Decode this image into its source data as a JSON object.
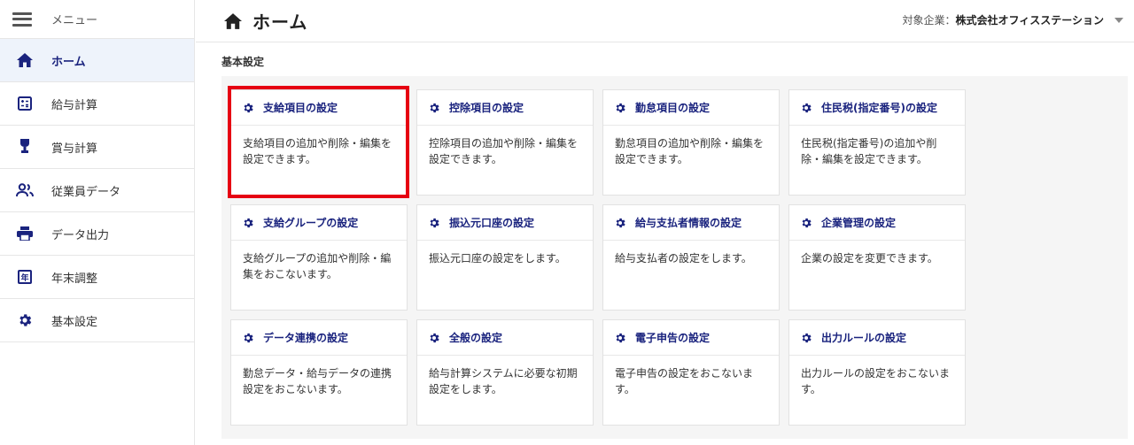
{
  "sidebar": {
    "menu_label": "メニュー",
    "items": [
      {
        "label": "ホーム",
        "icon": "home-icon"
      },
      {
        "label": "給与計算",
        "icon": "calculator-icon"
      },
      {
        "label": "賞与計算",
        "icon": "bonus-icon"
      },
      {
        "label": "従業員データ",
        "icon": "people-icon"
      },
      {
        "label": "データ出力",
        "icon": "printer-icon"
      },
      {
        "label": "年末調整",
        "icon": "year-icon"
      },
      {
        "label": "基本設定",
        "icon": "gear-icon"
      }
    ],
    "year_glyph": "年"
  },
  "header": {
    "title": "ホーム",
    "company_label": "対象企業：",
    "company_name": "株式会社オフィスステーション"
  },
  "section_title": "基本設定",
  "cards": [
    {
      "title": "支給項目の設定",
      "description": "支給項目の追加や削除・編集を設定できます。"
    },
    {
      "title": "控除項目の設定",
      "description": "控除項目の追加や削除・編集を設定できます。"
    },
    {
      "title": "勤怠項目の設定",
      "description": "勤怠項目の追加や削除・編集を設定できます。"
    },
    {
      "title": "住民税(指定番号)の設定",
      "description": "住民税(指定番号)の追加や削除・編集を設定できます。"
    },
    {
      "title": "支給グループの設定",
      "description": "支給グループの追加や削除・編集をおこないます。"
    },
    {
      "title": "振込元口座の設定",
      "description": "振込元口座の設定をします。"
    },
    {
      "title": "給与支払者情報の設定",
      "description": "給与支払者の設定をします。"
    },
    {
      "title": "企業管理の設定",
      "description": "企業の設定を変更できます。"
    },
    {
      "title": "データ連携の設定",
      "description": "勤怠データ・給与データの連携設定をおこないます。"
    },
    {
      "title": "全般の設定",
      "description": "給与計算システムに必要な初期設定をします。"
    },
    {
      "title": "電子申告の設定",
      "description": "電子申告の設定をおこないます。"
    },
    {
      "title": "出力ルールの設定",
      "description": "出力ルールの設定をおこないます。"
    }
  ],
  "colors": {
    "accent": "#1a237e",
    "highlight": "#e60012",
    "active_bg": "#eef3fb"
  }
}
